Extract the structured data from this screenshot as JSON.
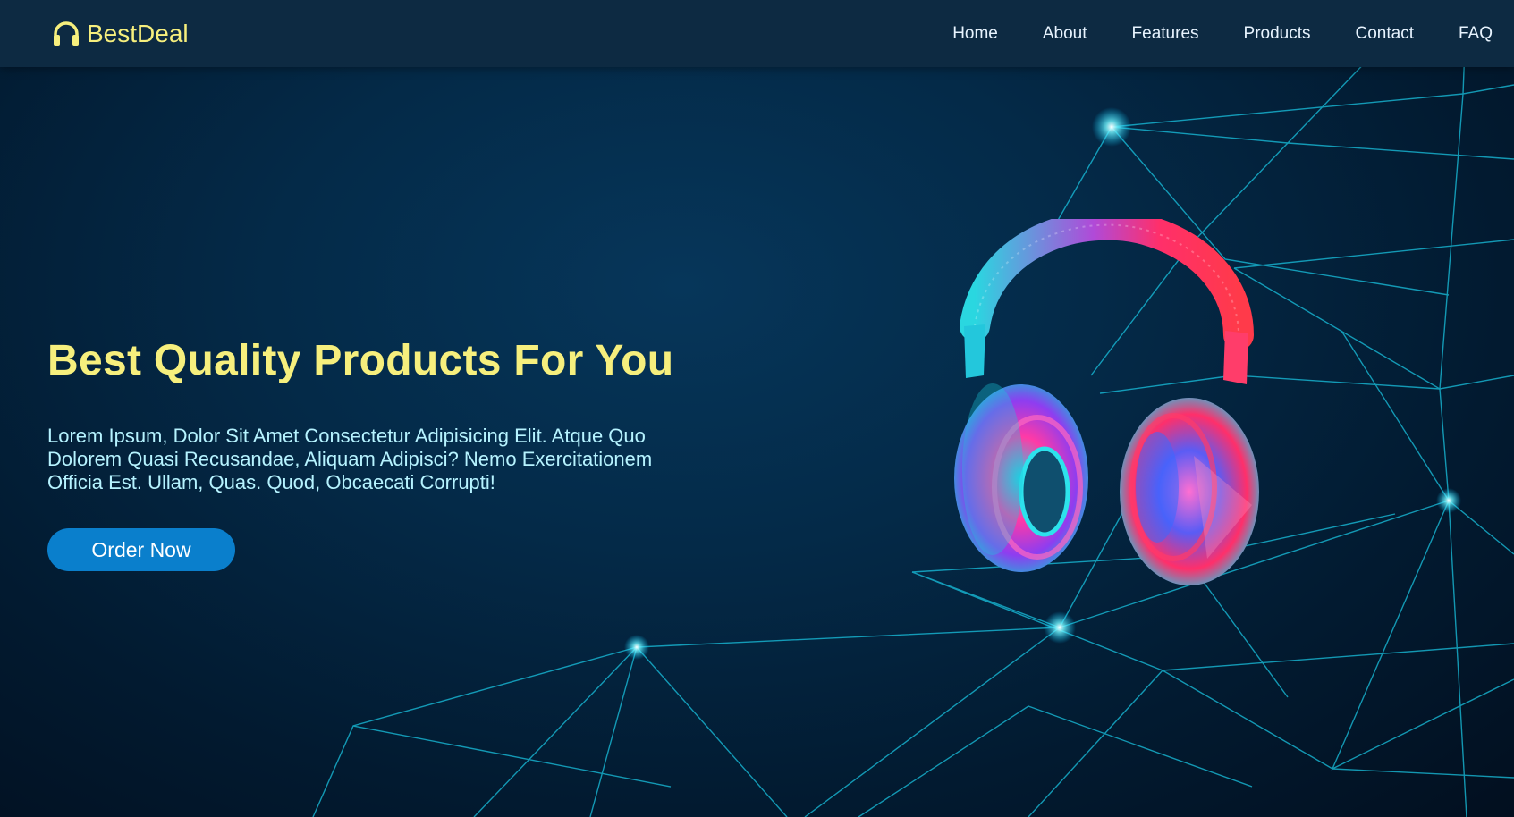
{
  "brand": {
    "name": "BestDeal",
    "icon": "headphones-icon",
    "color": "#f6ef7d"
  },
  "nav": {
    "items": [
      {
        "label": "Home"
      },
      {
        "label": "About"
      },
      {
        "label": "Features"
      },
      {
        "label": "Products"
      },
      {
        "label": "Contact"
      },
      {
        "label": "FAQ"
      }
    ]
  },
  "hero": {
    "title": "Best Quality Products For You",
    "description": "Lorem Ipsum, Dolor Sit Amet Consectetur Adipisicing Elit. Atque Quo Dolorem Quasi Recusandae, Aliquam Adipisci? Nemo Exercitationem Officia Est. Ullam, Quas. Quod, Obcaecati Corrupti!",
    "cta_label": "Order Now"
  },
  "colors": {
    "accent": "#f6ef7d",
    "button": "#0a7fcc",
    "navbar": "#0d2a42",
    "text": "#b6f3ff"
  },
  "image": {
    "subject": "headphones-illustration"
  }
}
